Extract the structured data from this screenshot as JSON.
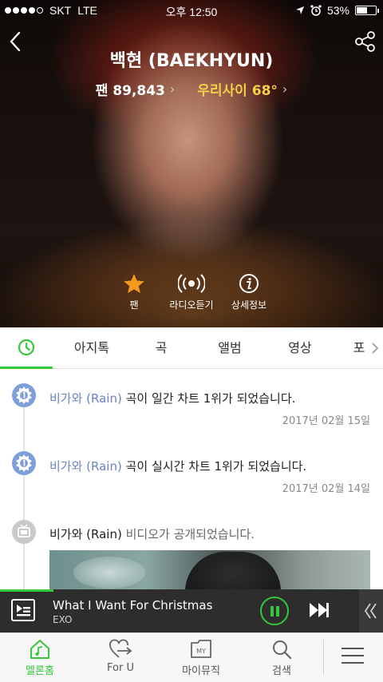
{
  "status_bar": {
    "carrier": "SKT",
    "network": "LTE",
    "time": "오후 12:50",
    "battery": "53%"
  },
  "artist": {
    "name": "백현 (BAEKHYUN)",
    "fan_label": "팬 89,843",
    "bond_label": "우리사이 68°"
  },
  "actions": [
    {
      "label": "팬",
      "icon": "star-icon"
    },
    {
      "label": "라디오듣기",
      "icon": "radio-icon"
    },
    {
      "label": "상세정보",
      "icon": "info-icon"
    }
  ],
  "tabs": [
    {
      "label": "아지톡"
    },
    {
      "label": "곡"
    },
    {
      "label": "앨범"
    },
    {
      "label": "영상"
    },
    {
      "label": "포"
    }
  ],
  "feed": [
    {
      "link": "비가와 (Rain)",
      "text": " 곡이 일간 차트 1위가 되었습니다.",
      "date": "2017년 02월 15일",
      "icon": "chart-medal-icon"
    },
    {
      "link": "비가와 (Rain)",
      "text": " 곡이 실시간 차트 1위가 되었습니다.",
      "date": "2017년 02월 14일",
      "icon": "chart-medal-icon"
    },
    {
      "link": "비가와 (Rain)",
      "text": " 비디오가 공개되었습니다.",
      "icon": "tv-icon"
    }
  ],
  "player": {
    "song": "What I Want For Christmas",
    "artist": "EXO",
    "progress": 0.14
  },
  "bottom_nav": [
    {
      "label": "멜론홈",
      "active": true
    },
    {
      "label": "For U",
      "active": false
    },
    {
      "label": "마이뮤직",
      "active": false
    },
    {
      "label": "검색",
      "active": false
    }
  ],
  "colors": {
    "accent": "#35c73c",
    "link": "#6b84c4",
    "bond": "#f4cf4a"
  }
}
